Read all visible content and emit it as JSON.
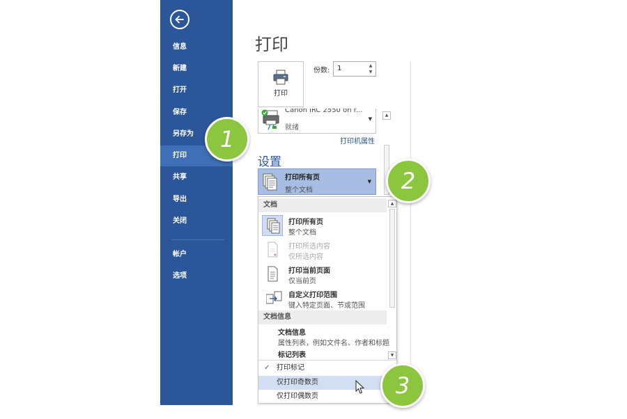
{
  "sidebar": {
    "items": [
      {
        "label": "信息"
      },
      {
        "label": "新建"
      },
      {
        "label": "打开"
      },
      {
        "label": "保存"
      },
      {
        "label": "另存为"
      },
      {
        "label": "打印"
      },
      {
        "label": "共享"
      },
      {
        "label": "导出"
      },
      {
        "label": "关闭"
      },
      {
        "label": "帐户"
      },
      {
        "label": "选项"
      }
    ],
    "active": "打印"
  },
  "main": {
    "title": "打印",
    "print_button": {
      "label": "打印"
    },
    "copies": {
      "label": "份数:",
      "value": "1"
    },
    "printer": {
      "name": "Canon iRC 2550 on r...",
      "status": "就绪",
      "properties_link": "打印机属性"
    },
    "settings_heading": "设置",
    "range_select": {
      "title": "打印所有页",
      "subtitle": "整个文档"
    }
  },
  "dropdown": {
    "sections": [
      {
        "header": "文档"
      },
      {
        "header": "文档信息"
      }
    ],
    "options": [
      {
        "title": "打印所有页",
        "subtitle": "整个文档"
      },
      {
        "title": "打印所选内容",
        "subtitle": "仅所选内容"
      },
      {
        "title": "打印当前页面",
        "subtitle": "仅当前页"
      },
      {
        "title": "自定义打印范围",
        "subtitle": "键入特定页面、节或范围"
      }
    ],
    "info_items": [
      {
        "title": "文档信息",
        "subtitle": "属性列表，例如文件名、作者和标题"
      },
      {
        "title": "标记列表"
      }
    ],
    "flags": [
      {
        "label": "打印标记",
        "checked": true
      },
      {
        "label": "仅打印奇数页"
      },
      {
        "label": "仅打印偶数页"
      }
    ]
  },
  "badges": [
    "1",
    "2",
    "3"
  ],
  "colors": {
    "sidebar": "#2b579a",
    "sidebar_active": "#3f6fb6",
    "accent": "#2b579a",
    "badge": "#8cc63f",
    "selected": "#a7bde3"
  }
}
